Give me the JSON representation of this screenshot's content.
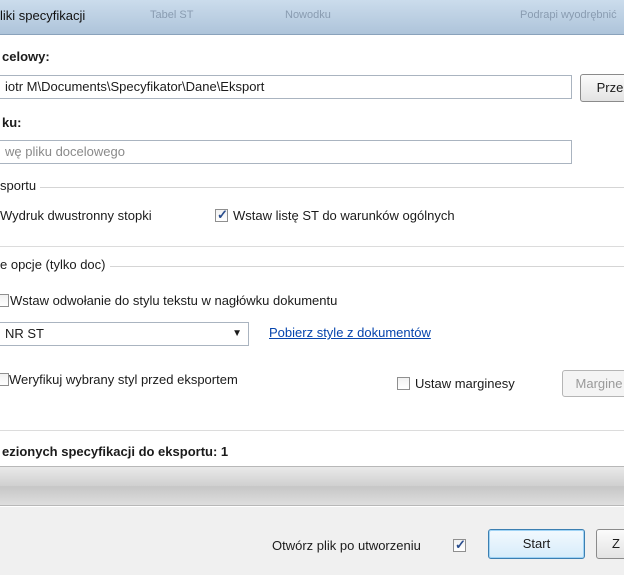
{
  "window": {
    "title": "liki specyfikacji"
  },
  "background_tabs": [
    "Tabel ST",
    "Nowodku",
    "Podrapi wyodrębnić"
  ],
  "target": {
    "label": "celowy:",
    "path": "iotr M\\Documents\\Specyfikator\\Dane\\Eksport",
    "browse_label": "Prze"
  },
  "file": {
    "label": "ku:",
    "placeholder": "wę pliku docelowego"
  },
  "export_group": {
    "title": "sportu",
    "duplex_label": "Wydruk dwustronny stopki",
    "insert_list_label": "Wstaw listę ST do warunków ogólnych",
    "insert_list_checked": true
  },
  "doc_group": {
    "title": "e opcje (tylko doc)",
    "style_ref_label": "Wstaw odwołanie do stylu tekstu w nagłówku dokumentu",
    "style_ref_checked": false,
    "style_value": "NR ST",
    "fetch_styles_link": "Pobierz style z dokumentów",
    "verify_label": "Weryfikuj wybrany styl przed eksportem",
    "margins_label": "Ustaw marginesy",
    "margins_checked": false,
    "margins_button": "Margine"
  },
  "summary": {
    "text": "ezionych specyfikacji do eksportu: 1"
  },
  "footer": {
    "open_after_label": "Otwórz plik po utworzeniu",
    "open_after_checked": true,
    "start_label": "Start",
    "close_label": "Z"
  }
}
